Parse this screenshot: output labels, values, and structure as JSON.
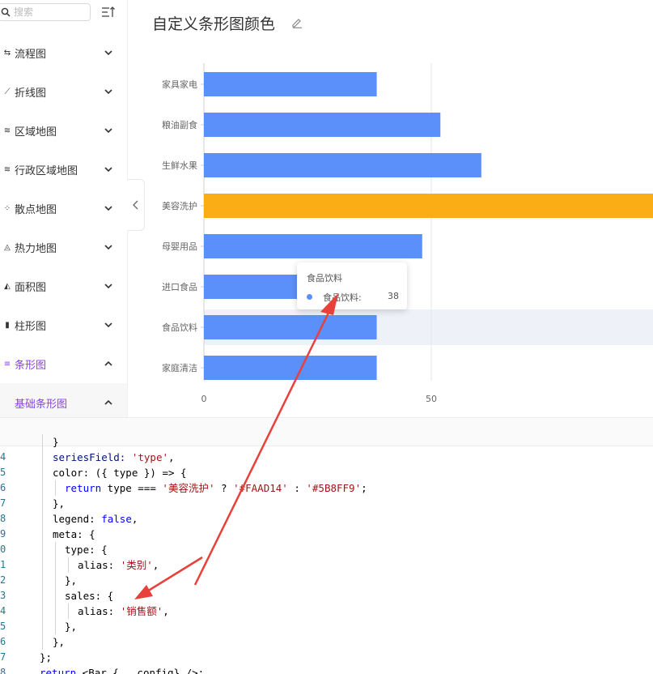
{
  "search": {
    "placeholder": "搜索"
  },
  "sidebar": {
    "items": [
      {
        "label": "流程图",
        "icon": "flow-icon"
      },
      {
        "label": "折线图",
        "icon": "line-chart-icon"
      },
      {
        "label": "区域地图",
        "icon": "area-map-icon"
      },
      {
        "label": "行政区域地图",
        "icon": "admin-map-icon"
      },
      {
        "label": "散点地图",
        "icon": "scatter-map-icon"
      },
      {
        "label": "热力地图",
        "icon": "heat-map-icon"
      },
      {
        "label": "面积图",
        "icon": "area-chart-icon"
      },
      {
        "label": "柱形图",
        "icon": "column-chart-icon"
      },
      {
        "label": "条形图",
        "icon": "bar-chart-icon"
      }
    ],
    "sub_item": {
      "label": "基础条形图"
    },
    "accent_color": "#8b41f3"
  },
  "header": {
    "title": "自定义条形图颜色"
  },
  "chart_data": {
    "type": "bar",
    "orientation": "horizontal",
    "categories": [
      "家具家电",
      "粮油副食",
      "生鲜水果",
      "美容洗护",
      "母婴用品",
      "进口食品",
      "食品饮料",
      "家庭清洁"
    ],
    "values": [
      38,
      52,
      61,
      145,
      48,
      38,
      38,
      38
    ],
    "colors": {
      "default": "#5B8FF9",
      "highlight": "#FAAD14"
    },
    "highlight_category": "美容洗护",
    "x_ticks": [
      "0",
      "50"
    ],
    "xlim": [
      0,
      100
    ],
    "grid": true,
    "hovered_category": "食品饮料"
  },
  "tooltip": {
    "title": "食品饮料",
    "name": "食品饮料:",
    "value": "38"
  },
  "code": {
    "lines": [
      {
        "num": "",
        "text": ""
      },
      {
        "num": "4",
        "indent": 1
      },
      {
        "num": "5",
        "indent": 1
      },
      {
        "num": "6",
        "indent": 2
      },
      {
        "num": "7",
        "indent": 1
      },
      {
        "num": "8",
        "indent": 1
      },
      {
        "num": "9",
        "indent": 1
      },
      {
        "num": "0",
        "indent": 2
      },
      {
        "num": "1",
        "indent": 3
      },
      {
        "num": "2",
        "indent": 2
      },
      {
        "num": "3",
        "indent": 2
      },
      {
        "num": "4",
        "indent": 3
      },
      {
        "num": "5",
        "indent": 2
      },
      {
        "num": "6",
        "indent": 1
      },
      {
        "num": "7",
        "indent": 0
      },
      {
        "num": "8",
        "indent": 0
      }
    ],
    "text": {
      "l4": "seriesField: 'type',",
      "l5": "color: ({ type }) => {",
      "l6_kw": "return",
      "l6_a": " type === ",
      "l6_s1": "'美容洗护'",
      "l6_b": " ? ",
      "l6_s2": "'#FAAD14'",
      "l6_c": " : ",
      "l6_s3": "'#5B8FF9'",
      "l6_d": ";",
      "l7": "},",
      "l8_a": "legend: ",
      "l8_kw": "false",
      "l8_b": ",",
      "l9": "meta: {",
      "l10": "type: {",
      "l11_a": "alias: ",
      "l11_s": "'类别'",
      "l11_b": ",",
      "l12": "},",
      "l13": "sales: {",
      "l14_a": "alias: ",
      "l14_s": "'销售额'",
      "l14_b": ",",
      "l15": "},",
      "l16": "},",
      "l17": "};",
      "l18_kw": "return",
      "l18_b": " <Bar {...config} />;"
    }
  }
}
